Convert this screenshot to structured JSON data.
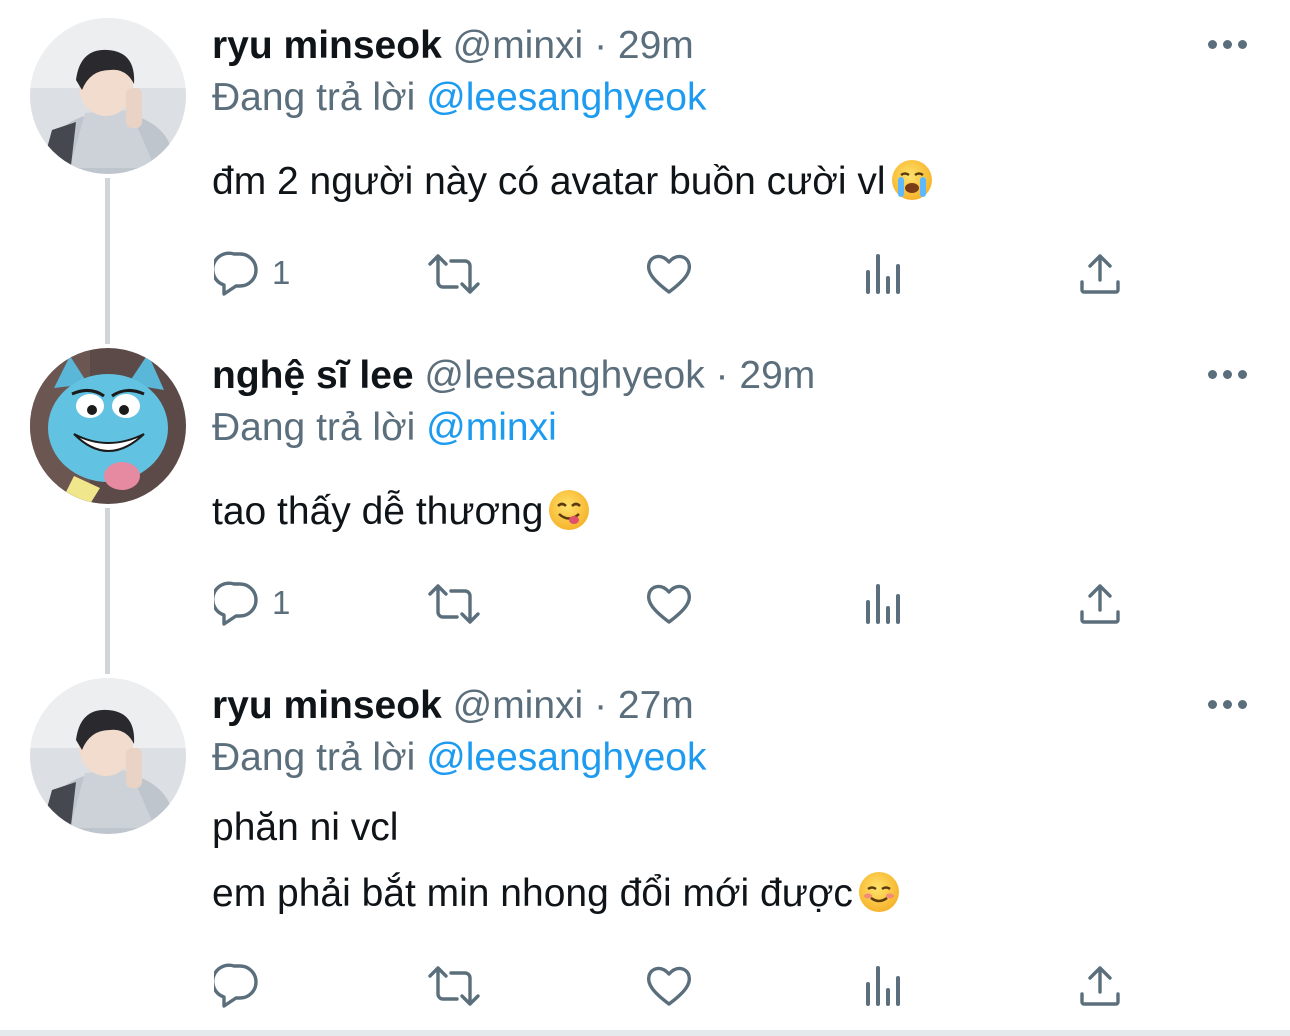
{
  "colors": {
    "text": "#0f1419",
    "muted": "#5b6e7c",
    "accent": "#1d9bf0",
    "thread_line": "#d0d5da"
  },
  "replying_prefix": "Đang trả lời",
  "tweets": [
    {
      "display_name": "ryu minseok",
      "handle": "@minxi",
      "separator": "·",
      "time": "29m",
      "reply_to": "@leesanghyeok",
      "lines": [
        "đm 2 người này có avatar buồn cười vl"
      ],
      "emoji": "loudly-crying-face",
      "reply_count": "1",
      "avatar": "photo-person-avatar"
    },
    {
      "display_name": "nghệ sĩ lee",
      "handle": "@leesanghyeok",
      "separator": "·",
      "time": "29m",
      "reply_to": "@minxi",
      "lines": [
        "tao thấy dễ thương"
      ],
      "emoji": "face-savoring-food",
      "reply_count": "1",
      "avatar": "cartoon-cat-avatar"
    },
    {
      "display_name": "ryu minseok",
      "handle": "@minxi",
      "separator": "·",
      "time": "27m",
      "reply_to": "@leesanghyeok",
      "lines": [
        "phăn ni vcl",
        "em phải bắt min nhong đổi mới được"
      ],
      "emoji": "smiling-face",
      "reply_count": "",
      "avatar": "photo-person-avatar"
    }
  ]
}
